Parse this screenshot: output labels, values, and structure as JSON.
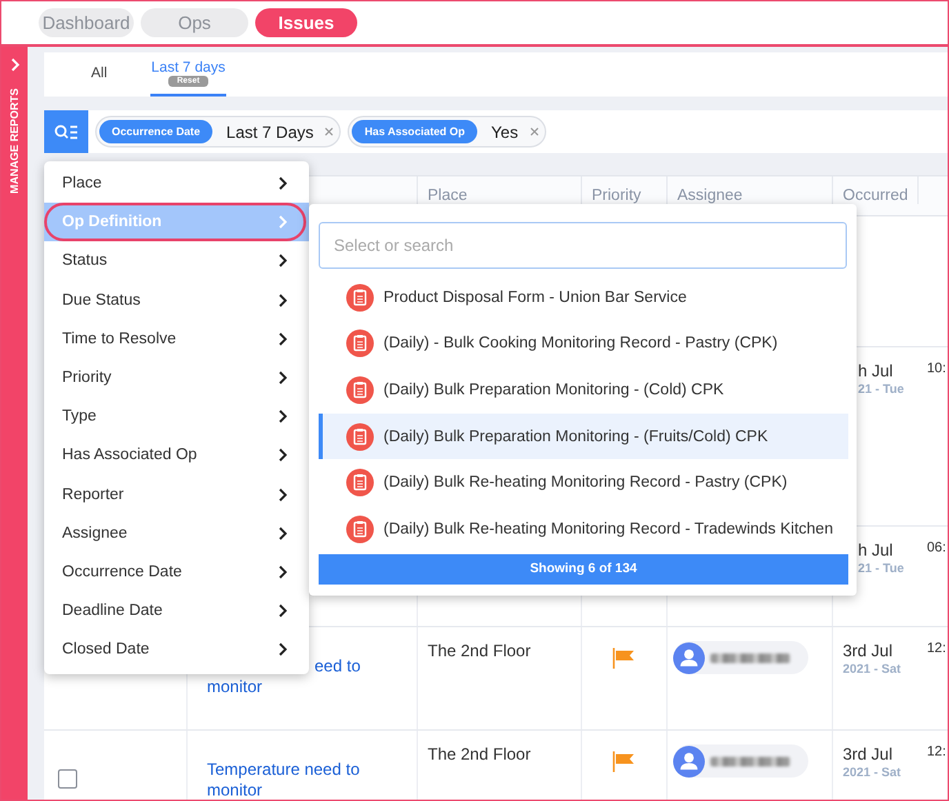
{
  "top_tabs": [
    {
      "label": "Dashboard",
      "selected": false
    },
    {
      "label": "Ops",
      "selected": false
    },
    {
      "label": "Issues",
      "selected": true
    }
  ],
  "sidebar": {
    "label": "MANAGE REPORTS"
  },
  "sub_tabs": [
    {
      "label": "All",
      "selected": false
    },
    {
      "label": "Last 7 days",
      "selected": true,
      "badge": "Reset"
    }
  ],
  "filters": [
    {
      "field": "Occurrence Date",
      "value": "Last 7 Days"
    },
    {
      "field": "Has Associated Op",
      "value": "Yes"
    }
  ],
  "table": {
    "columns": [
      "Place",
      "Priority",
      "Assignee",
      "Occurred"
    ],
    "rows": [
      {
        "occurred": {
          "date": "h Jul",
          "day": "21 - Tue",
          "covered": true
        },
        "time": "10:"
      },
      {
        "occurred": {
          "date": "h Jul",
          "day": "21 - Tue",
          "covered": true
        },
        "time": "06:"
      },
      {
        "title": {
          "text": "eed to monitor",
          "covered": true
        },
        "place": "The 2nd Floor",
        "flag": true,
        "assignee": true,
        "occurred": {
          "date": "3rd Jul",
          "day": "2021 - Sat",
          "covered": false
        },
        "time": "12:"
      },
      {
        "checked": false,
        "title": {
          "text": "Temperature need to monitor",
          "covered": false
        },
        "place": "The 2nd Floor",
        "flag": true,
        "assignee": true,
        "occurred": {
          "date": "3rd Jul",
          "day": "2021 - Sat",
          "covered": false
        },
        "time": "12:"
      }
    ]
  },
  "filter_menu": {
    "items": [
      {
        "label": "Place",
        "selected": false,
        "circled": false
      },
      {
        "label": "Op Definition",
        "selected": true,
        "circled": true
      },
      {
        "label": "Status",
        "selected": false,
        "circled": false
      },
      {
        "label": "Due Status",
        "selected": false,
        "circled": false
      },
      {
        "label": "Time to Resolve",
        "selected": false,
        "circled": false
      },
      {
        "label": "Priority",
        "selected": false,
        "circled": false
      },
      {
        "label": "Type",
        "selected": false,
        "circled": false
      },
      {
        "label": "Has Associated Op",
        "selected": false,
        "circled": false
      },
      {
        "label": "Reporter",
        "selected": false,
        "circled": false
      },
      {
        "label": "Assignee",
        "selected": false,
        "circled": false
      },
      {
        "label": "Occurrence Date",
        "selected": false,
        "circled": false
      },
      {
        "label": "Deadline Date",
        "selected": false,
        "circled": false
      },
      {
        "label": "Closed Date",
        "selected": false,
        "circled": false
      }
    ]
  },
  "submenu": {
    "placeholder": "Select or search",
    "items": [
      {
        "label": "Product Disposal Form - Union Bar Service",
        "selected": false
      },
      {
        "label": "(Daily) - Bulk Cooking Monitoring Record - Pastry (CPK)",
        "selected": false
      },
      {
        "label": "(Daily) Bulk Preparation Monitoring - (Cold) CPK",
        "selected": false
      },
      {
        "label": "(Daily) Bulk Preparation Monitoring - (Fruits/Cold) CPK",
        "selected": true
      },
      {
        "label": "(Daily) Bulk Re-heating Monitoring Record - Pastry (CPK)",
        "selected": false
      },
      {
        "label": "(Daily) Bulk Re-heating Monitoring Record - Tradewinds Kitchen",
        "selected": false
      }
    ],
    "footer": "Showing 6 of 134"
  }
}
